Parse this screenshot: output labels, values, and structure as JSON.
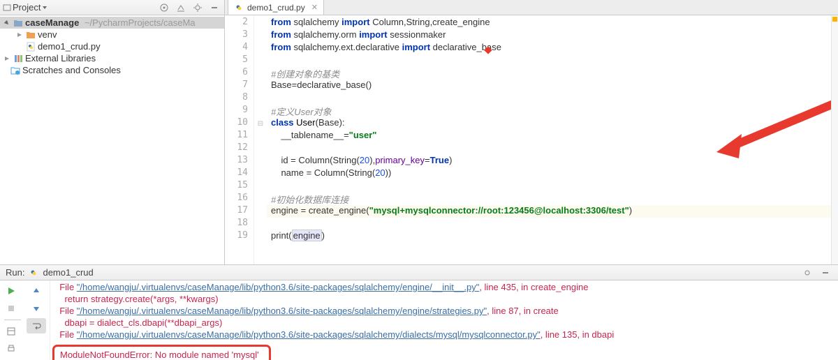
{
  "sidebar": {
    "title": "Project",
    "project_name": "caseManage",
    "project_path": "~/PycharmProjects/caseMa",
    "venv": "venv",
    "file": "demo1_crud.py",
    "ext_lib": "External Libraries",
    "scratches": "Scratches and Consoles"
  },
  "tab": {
    "name": "demo1_crud.py"
  },
  "code": {
    "lines": [
      {
        "n": 2,
        "mk": "",
        "html": "<span class='kw'>from</span> sqlalchemy <span class='kw'>import</span> Column,String,create_engine"
      },
      {
        "n": 3,
        "mk": "",
        "html": "<span class='kw'>from</span> sqlalchemy.orm <span class='kw'>import</span> sessionmaker"
      },
      {
        "n": 4,
        "mk": "",
        "html": "<span class='kw'>from</span> sqlalchemy.ext.declarative <span class='kw'>import</span> declarative_base"
      },
      {
        "n": 5,
        "mk": "",
        "html": ""
      },
      {
        "n": 6,
        "mk": "",
        "html": "<span class='cmt'>#创建对象的基类</span>"
      },
      {
        "n": 7,
        "mk": "",
        "html": "Base=declarative_base()"
      },
      {
        "n": 8,
        "mk": "",
        "html": ""
      },
      {
        "n": 9,
        "mk": "",
        "html": "<span class='cmt'>#定义User对象</span>"
      },
      {
        "n": 10,
        "mk": "-",
        "html": "<span class='kw'>class</span> <span class='darkbold'>User</span>(Base):"
      },
      {
        "n": 11,
        "mk": "",
        "html": "    __tablename__=<span class='str'>\"user\"</span>"
      },
      {
        "n": 12,
        "mk": "",
        "html": ""
      },
      {
        "n": 13,
        "mk": "",
        "html": "    id = Column(String(<span class='num'>20</span>),<span class='par'>primary_key</span>=<span class='kw'>True</span>)"
      },
      {
        "n": 14,
        "mk": "",
        "html": "    name = Column(String(<span class='num'>20</span>))"
      },
      {
        "n": 15,
        "mk": "",
        "html": ""
      },
      {
        "n": 16,
        "mk": "",
        "html": "<span class='cmt'>#初始化数据库连接</span>"
      },
      {
        "n": 17,
        "mk": "",
        "hl": true,
        "html": "engine = create_engine(<span class='str'>\"mysql+mysqlconnector://root:123456@localhost:3306/test\"</span>)"
      },
      {
        "n": 18,
        "mk": "",
        "html": ""
      },
      {
        "n": 19,
        "mk": "",
        "html": "print(<span class='box'>engine</span>)"
      }
    ]
  },
  "run": {
    "label": "Run:",
    "config": "demo1_crud",
    "logs": [
      {
        "indent": 2,
        "html": "File <span class='path'>\"/home/wangju/.virtualenvs/caseManage/lib/python3.6/site-packages/sqlalchemy/engine/__init__.py\"</span>, line 435, in create_engine"
      },
      {
        "indent": 4,
        "html": "return strategy.create(*args, **kwargs)"
      },
      {
        "indent": 2,
        "html": "File <span class='path'>\"/home/wangju/.virtualenvs/caseManage/lib/python3.6/site-packages/sqlalchemy/engine/strategies.py\"</span>, line 87, in create"
      },
      {
        "indent": 4,
        "html": "dbapi = dialect_cls.dbapi(**dbapi_args)"
      },
      {
        "indent": 2,
        "html": "File <span class='path'>\"/home/wangju/.virtualenvs/caseManage/lib/python3.6/site-packages/sqlalchemy/dialects/mysql/mysqlconnector.py\"</span>, line 135, in dbapi"
      }
    ],
    "final_error": "ModuleNotFoundError: No module named 'mysql'"
  }
}
